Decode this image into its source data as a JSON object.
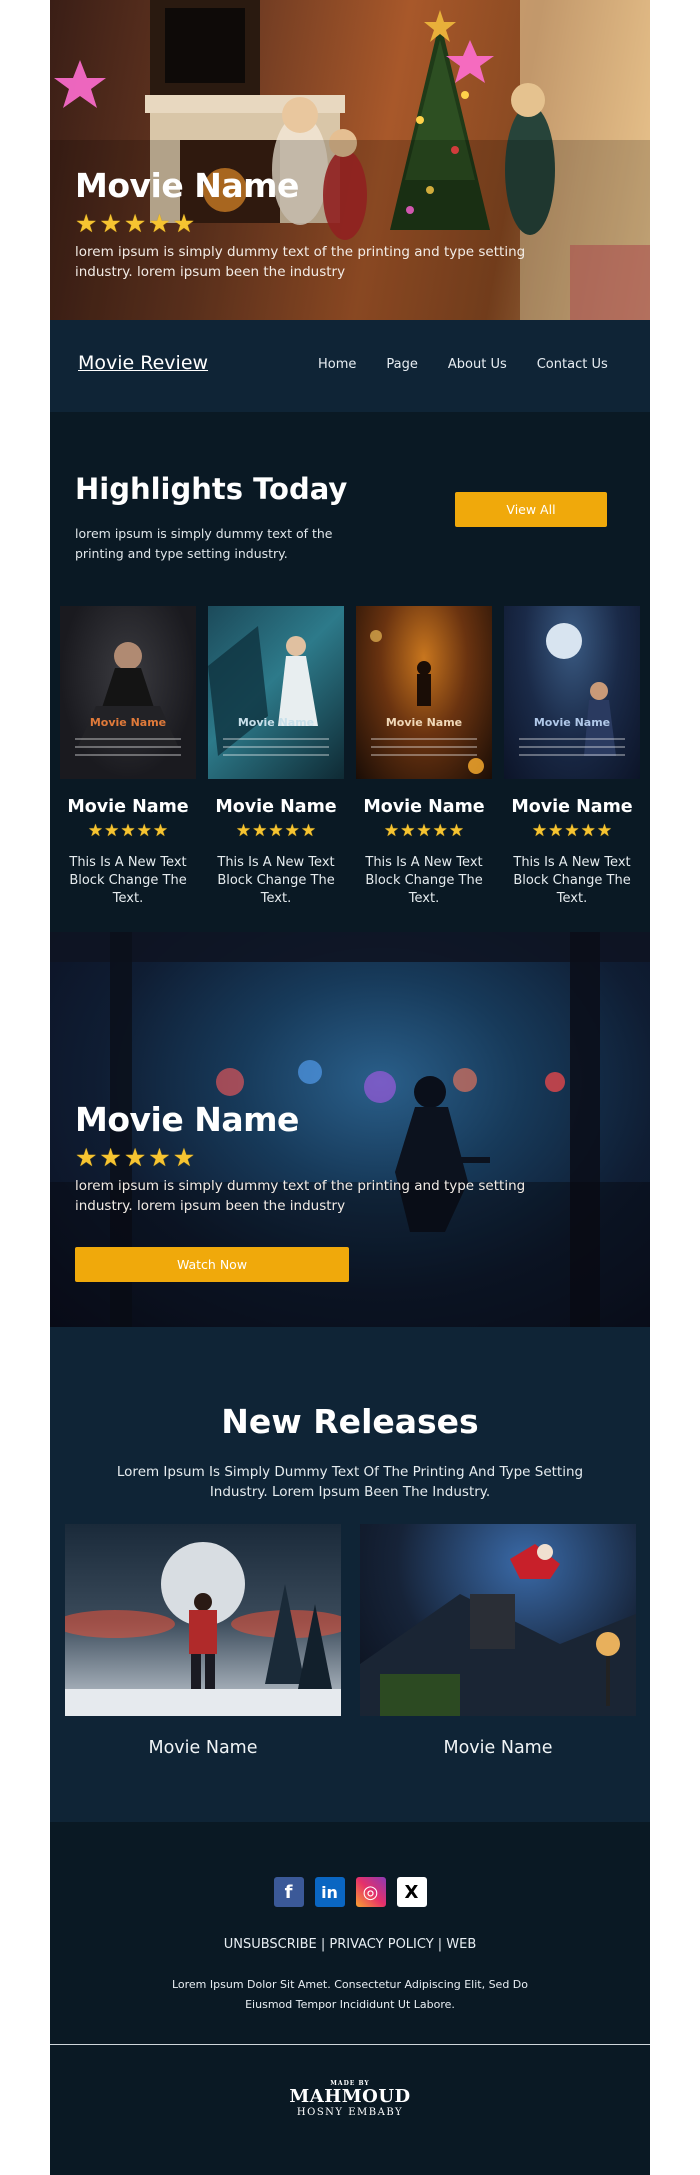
{
  "hero": {
    "title": "Movie Name",
    "rating": 5,
    "stars": "★★★★★",
    "description": "lorem ipsum is simply dummy text of the printing and type setting industry. lorem ipsum been the industry"
  },
  "nav": {
    "brand": "Movie Review",
    "items": [
      {
        "label": "Home"
      },
      {
        "label": "Page"
      },
      {
        "label": "About Us"
      },
      {
        "label": "Contact Us"
      }
    ]
  },
  "highlights": {
    "title": "Highlights Today",
    "description": "lorem ipsum is simply dummy text of the printing and type setting industry.",
    "view_all_label": "View All",
    "cards": [
      {
        "poster_label": "Movie Name",
        "name": "Movie Name",
        "stars": "★★★★★",
        "text": "This Is A New Text Block Change The Text."
      },
      {
        "poster_label": "Movie Name",
        "name": "Movie Name",
        "stars": "★★★★★",
        "text": "This Is A New Text Block Change The Text."
      },
      {
        "poster_label": "Movie Name",
        "name": "Movie Name",
        "stars": "★★★★★",
        "text": "This Is A New Text Block Change The Text."
      },
      {
        "poster_label": "Movie Name",
        "name": "Movie Name",
        "stars": "★★★★★",
        "text": "This Is A New Text Block Change The Text."
      }
    ]
  },
  "feature": {
    "title": "Movie Name",
    "stars": "★★★★★",
    "description": "lorem ipsum is simply dummy text of the printing and type setting industry. lorem ipsum been the industry",
    "watch_label": "Watch Now"
  },
  "releases": {
    "title": "New Releases",
    "description": "Lorem Ipsum Is Simply Dummy Text Of The Printing And Type Setting Industry. Lorem Ipsum Been The Industry.",
    "items": [
      {
        "name": "Movie Name"
      },
      {
        "name": "Movie Name"
      }
    ]
  },
  "footer": {
    "social": [
      {
        "icon": "facebook-icon",
        "glyph": "f"
      },
      {
        "icon": "linkedin-icon",
        "glyph": "in"
      },
      {
        "icon": "instagram-icon",
        "glyph": "◎"
      },
      {
        "icon": "x-icon",
        "glyph": "X"
      }
    ],
    "links": "UNSUBSCRIBE | PRIVACY POLICY | WEB",
    "text": "Lorem Ipsum Dolor Sit Amet. Consectetur Adipiscing Elit, Sed Do Eiusmod Tempor Incididunt Ut Labore.",
    "logo": {
      "made_by": "MADE BY",
      "name": "MAHMOUD",
      "subtitle": "HOSNY EMBABY"
    }
  },
  "colors": {
    "accent": "#f0a90b",
    "star": "#f6c431",
    "nav_bg": "#0f2436",
    "section_bg": "#0a1924"
  }
}
